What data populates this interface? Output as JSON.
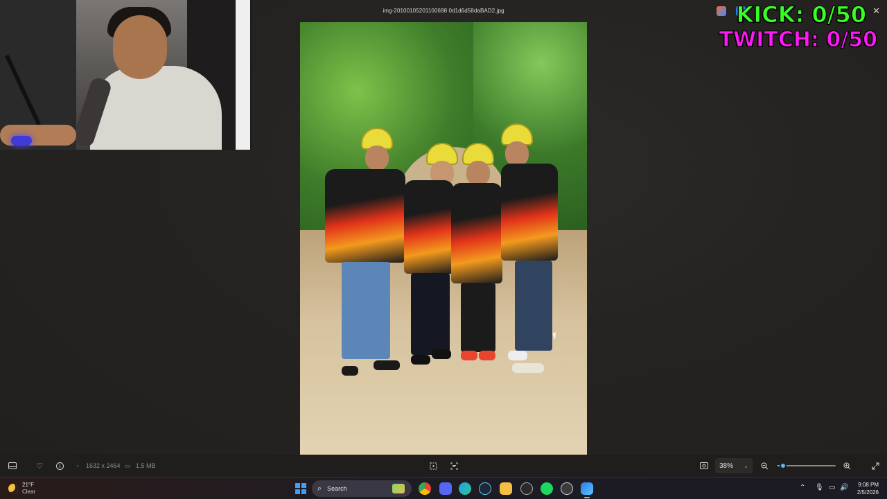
{
  "window": {
    "title": "img-20100105201100698 0d1d6d58daBAD2.jpg",
    "close_glyph": "✕"
  },
  "overlay": {
    "kick": "KICK: 0/50",
    "twitch": "TWITCH: 0/50",
    "kick_color": "#38ff22",
    "twitch_color": "#ff18f6"
  },
  "toolbar": {
    "dimensions": "1632 x 2464",
    "file_size": "1.5 MB",
    "zoom_level": "38%",
    "zoom_fraction": 0.1,
    "icons": [
      "filmstrip-icon",
      "heart-icon",
      "info-icon",
      "crop-icon",
      "scan-icon",
      "fit-icon",
      "zoom-out-icon",
      "zoom-in-icon",
      "expand-icon"
    ]
  },
  "taskbar": {
    "temperature": "21°F",
    "condition": "Clear",
    "search_placeholder": "Search",
    "time": "9:08 PM",
    "date": "2/5/2026",
    "apps": [
      "chrome",
      "discord",
      "edge",
      "steam",
      "file-explorer",
      "obs",
      "spotify",
      "tool",
      "photos"
    ]
  },
  "colors": {
    "accent": "#5fb2ff",
    "windows_blue": "#3aa0ff"
  }
}
